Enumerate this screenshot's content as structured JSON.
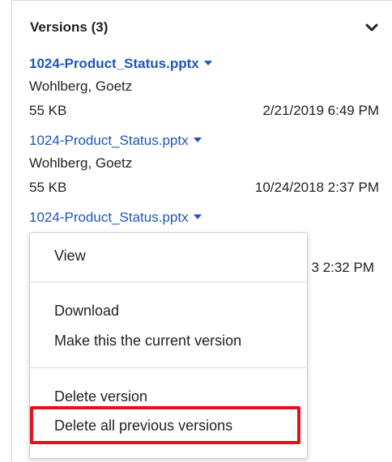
{
  "panel": {
    "title": "Versions (3)",
    "toggle_icon": "chevron-down-icon"
  },
  "versions": [
    {
      "name": "1024-Product_Status.pptx",
      "author": "Wohlberg, Goetz",
      "size": "55 KB",
      "date": "2/21/2019 6:49 PM",
      "current": true
    },
    {
      "name": "1024-Product_Status.pptx",
      "author": "Wohlberg, Goetz",
      "size": "55 KB",
      "date": "10/24/2018 2:37 PM",
      "current": false
    },
    {
      "name": "1024-Product_Status.pptx",
      "author": "",
      "size": "",
      "date": "3 2:32 PM",
      "current": false
    }
  ],
  "context_menu": {
    "items": [
      {
        "label": "View"
      },
      {
        "label": "Download"
      },
      {
        "label": "Make this the current version"
      },
      {
        "label": "Delete version"
      },
      {
        "label": "Delete all previous versions",
        "highlighted": true
      }
    ]
  },
  "colors": {
    "link": "#1f57b8",
    "highlight_border": "#e3111b"
  }
}
